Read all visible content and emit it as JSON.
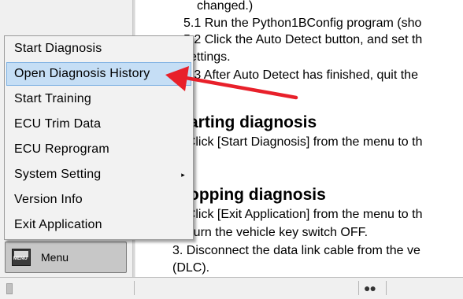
{
  "document": {
    "lines": [
      "changed.)",
      "5.1 Run the Python1BConfig program (sho",
      "5.2 Click the Auto Detect button, and set th",
      "settings.",
      "5.3 After Auto Detect has finished, quit the",
      "Starting diagnosis",
      "1. Click [Start Diagnosis] from the menu to th",
      "Stopping diagnosis",
      "1. Click [Exit Application] from the menu to th",
      "2. Turn the vehicle key switch OFF.",
      "3. Disconnect the data link cable from the ve",
      "(DLC)."
    ]
  },
  "popup_menu": {
    "items": [
      {
        "label": "Start Diagnosis"
      },
      {
        "label": "Open Diagnosis History",
        "selected": true
      },
      {
        "label": "Start Training"
      },
      {
        "label": "ECU Trim Data"
      },
      {
        "label": "ECU Reprogram"
      },
      {
        "label": "System Setting",
        "has_submenu": true,
        "submenu_glyph": "▸"
      },
      {
        "label": "Version Info"
      },
      {
        "label": "Exit Application"
      }
    ]
  },
  "menu_button": {
    "label": "Menu",
    "icon": "menu-icon",
    "icon_text": "MENU"
  },
  "statusbar": {
    "dots": "●●"
  },
  "annotation": {
    "arrow_color": "#e8202a",
    "icon": "red-arrow"
  },
  "colors": {
    "selection_bg": "#c5def5",
    "selection_border": "#7fb2e3",
    "menu_bg": "#f2f2f2",
    "pane_bg": "#f0f0f0"
  }
}
